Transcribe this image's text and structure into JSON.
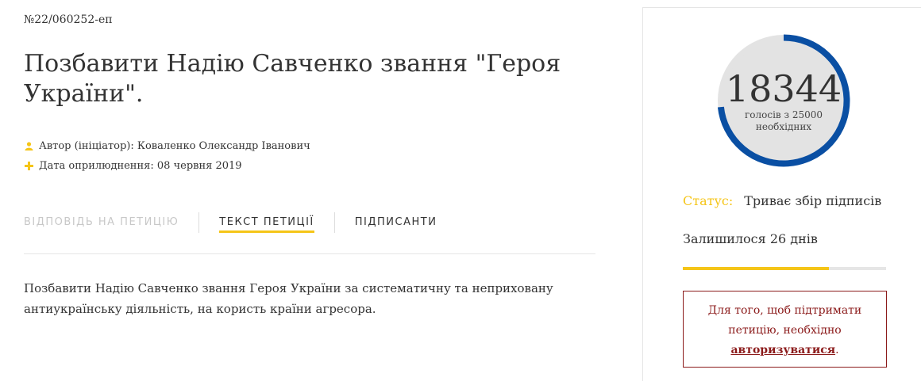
{
  "petition": {
    "number": "№22/060252-еп",
    "title": "Позбавити Надію Савченко звання \"Героя України\".",
    "author_label": "Автор (ініціатор):",
    "author_name": "Коваленко Олександр Іванович",
    "date_label": "Дата оприлюднення:",
    "date_value": "08 червня 2019",
    "text": "Позбавити Надію Савченко звання Героя України за систематичну та неприховану антиукраїнську діяльність, на користь країни агресора."
  },
  "tabs": [
    {
      "label": "ВІДПОВІДЬ НА ПЕТИЦІЮ",
      "state": "disabled"
    },
    {
      "label": "ТЕКСТ ПЕТИЦІЇ",
      "state": "active"
    },
    {
      "label": "ПІДПИСАНТИ",
      "state": "normal"
    }
  ],
  "votes": {
    "count": "18344",
    "caption": "голосів з 25000 необхідних",
    "signed": 18344,
    "required": 25000
  },
  "status": {
    "label": "Статус:",
    "value": "Триває збір підписів"
  },
  "remaining": "Залишилося 26 днів",
  "time_progress": 0.72,
  "auth": {
    "text_before": "Для того, щоб підтримати петицію, необхідно",
    "link_label": "авторизуватися",
    "text_after": "."
  },
  "colors": {
    "accent": "#f5c518",
    "gauge_fill": "#0a4fa3",
    "gauge_bg": "#e3e3e3",
    "alert": "#8b1a1a"
  },
  "icons": {
    "author": "user-icon",
    "date": "plus-icon"
  }
}
